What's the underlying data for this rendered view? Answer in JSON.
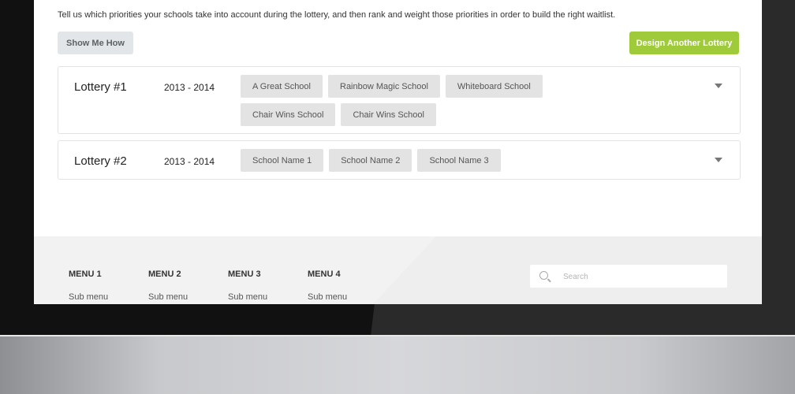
{
  "intro": "Tell us which priorities your schools take into account during the lottery, and then rank and weight those priorities in order to build the right waitlist.",
  "buttons": {
    "show_me_how": "Show Me How",
    "design_another": "Design Another Lottery"
  },
  "lotteries": [
    {
      "name": "Lottery #1",
      "year": "2013 - 2014",
      "schools": [
        "A Great School",
        "Rainbow Magic School",
        "Whiteboard School",
        "Chair Wins School",
        "Chair Wins School"
      ]
    },
    {
      "name": "Lottery #2",
      "year": "2013 - 2014",
      "schools": [
        "School Name 1",
        "School Name 2",
        "School Name 3"
      ]
    }
  ],
  "footer": {
    "menus": [
      {
        "title": "MENU 1",
        "sub": "Sub menu"
      },
      {
        "title": "MENU 2",
        "sub": "Sub menu"
      },
      {
        "title": "MENU 3",
        "sub": "Sub menu"
      },
      {
        "title": "MENU 4",
        "sub": "Sub menu"
      }
    ],
    "search_placeholder": "Search"
  },
  "colors": {
    "accent": "#9fcb3b",
    "tag_bg": "#e3e3e3"
  },
  "icons": [
    "chevron-down-icon",
    "search-icon"
  ]
}
